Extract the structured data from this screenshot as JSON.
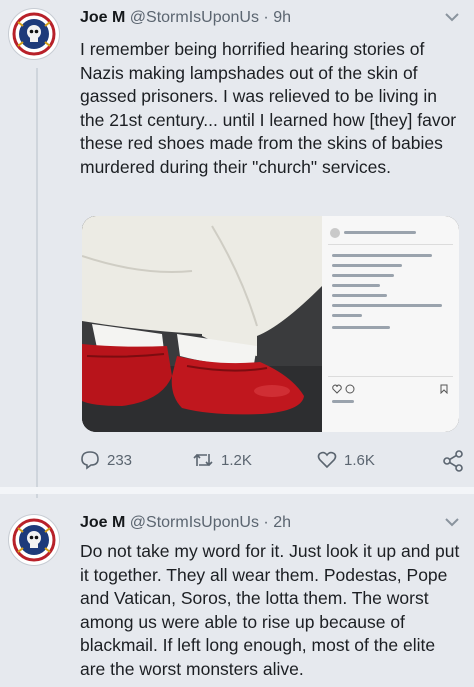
{
  "tweets": [
    {
      "name": "Joe M",
      "handle": "@StormIsUponUs",
      "sep": "·",
      "time": "9h",
      "text": "I remember being horrified hearing stories of Nazis making lampshades out of the skin of gassed prisoners. I was relieved to be living in the 21st century... until I learned how [they] favor these red shoes made from the skins of babies murdered during their \"church\" services.",
      "stats": {
        "replies": "233",
        "retweets": "1.2K",
        "likes": "1.6K"
      }
    },
    {
      "name": "Joe M",
      "handle": "@StormIsUponUs",
      "sep": "·",
      "time": "2h",
      "text": "Do not take my word for it. Just look it up and put it together. They all wear them. Podestas, Pope and Vatican, Soros, the lotta them. The worst among us were able to rise up because of blackmail. If left long enough, most of the elite are the worst monsters alive."
    }
  ],
  "icons": {
    "reply": "reply-icon",
    "retweet": "retweet-icon",
    "like": "heart-icon",
    "share": "share-icon",
    "menu": "chevron-down-icon"
  },
  "colors": {
    "shoe_red": "#c0171e",
    "handle_gray": "#5b6570",
    "background": "#e6e9ee"
  }
}
